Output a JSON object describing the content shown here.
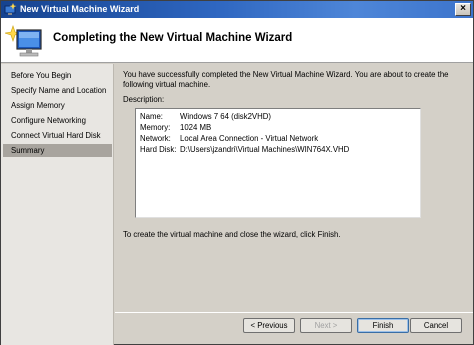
{
  "window": {
    "title": "New Virtual Machine Wizard"
  },
  "header": {
    "title": "Completing the New Virtual Machine Wizard"
  },
  "nav": {
    "items": [
      {
        "label": "Before You Begin"
      },
      {
        "label": "Specify Name and Location"
      },
      {
        "label": "Assign Memory"
      },
      {
        "label": "Configure Networking"
      },
      {
        "label": "Connect Virtual Hard Disk"
      },
      {
        "label": "Summary"
      }
    ],
    "selected": "Summary"
  },
  "main": {
    "intro": "You have successfully completed the New Virtual Machine Wizard. You are about to create the following virtual machine.",
    "description_label": "Description:",
    "description": [
      {
        "key": "Name:",
        "value": "Windows 7 64 (disk2VHD)"
      },
      {
        "key": "Memory:",
        "value": "1024 MB"
      },
      {
        "key": "Network:",
        "value": "Local Area Connection - Virtual Network"
      },
      {
        "key": "Hard Disk:",
        "value": "D:\\Users\\jzandri\\Virtual Machines\\WIN764X.VHD"
      }
    ],
    "finish_note": "To create the virtual machine and close the wizard, click Finish."
  },
  "buttons": {
    "previous": "< Previous",
    "next": "Next >",
    "finish": "Finish",
    "cancel": "Cancel"
  },
  "icons": {
    "title": "wizard-app-icon",
    "header": "virtual-machine-monitor-icon",
    "close": "close-icon"
  }
}
